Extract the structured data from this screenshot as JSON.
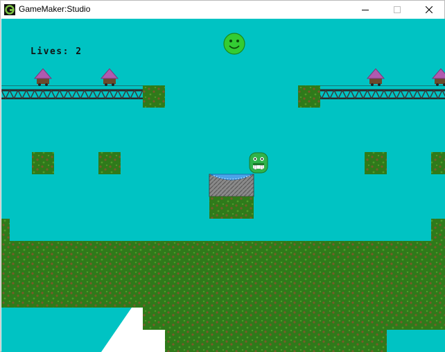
{
  "window": {
    "title": "GameMaker:Studio",
    "app_icon": "gamemaker-icon",
    "controls": [
      "minimize-icon",
      "maximize-icon",
      "close-icon"
    ]
  },
  "hud": {
    "lives_label": "Lives:",
    "lives_value": "2"
  },
  "colors": {
    "sky": "#00c3c3",
    "grass": "#2f7a1a",
    "grass_spot": "#7a5a2a",
    "rail": "#2b2b2b",
    "spike": "#b05ab0",
    "player": "#2fb34a",
    "coin_face": "#33cc33",
    "trampoline": "#6a6a6a",
    "ice": "#ffffff"
  },
  "sprites": {
    "player": "green-blob-with-fangs",
    "collectible": "green-smiley",
    "enemies": "purple-spike-cart",
    "trampoline": "spring-pad"
  }
}
